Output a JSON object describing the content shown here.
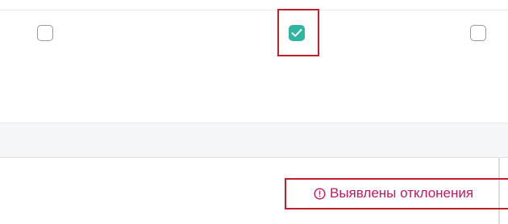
{
  "checkboxes": [
    {
      "checked": false
    },
    {
      "checked": true
    },
    {
      "checked": false
    }
  ],
  "status": {
    "icon": "info-circle-icon",
    "text": "Выявлены отклонения",
    "color": "#c2185b"
  },
  "colors": {
    "checkbox_checked": "#2fb5a0",
    "highlight_frame": "#c0212b"
  }
}
